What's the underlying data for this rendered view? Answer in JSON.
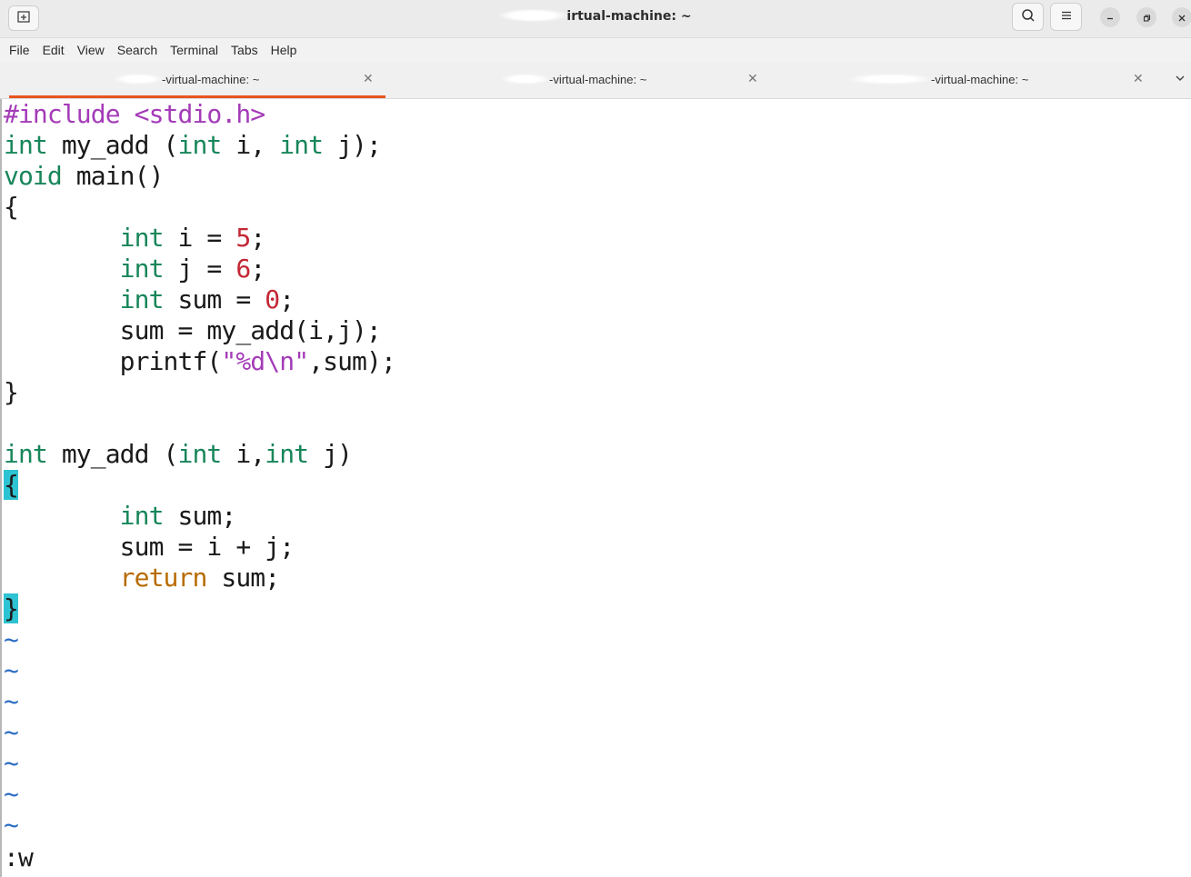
{
  "window": {
    "title": "irtual-machine: ~"
  },
  "menubar": [
    "File",
    "Edit",
    "View",
    "Search",
    "Terminal",
    "Tabs",
    "Help"
  ],
  "tabs": [
    {
      "label": "-virtual-machine: ~",
      "active": true
    },
    {
      "label": "-virtual-machine: ~",
      "active": false
    },
    {
      "label": "-virtual-machine: ~",
      "active": false
    }
  ],
  "colors": {
    "accent_tab": "#e95420",
    "keyword_type": "#18865a",
    "preprocessor": "#a43bb8",
    "number": "#c42734",
    "string": "#a43bb8",
    "return": "#b76b00",
    "tilde": "#2a6cc4",
    "brace_highlight": "#2ec3d2"
  },
  "icons": {
    "new_tab": "new-tab-icon",
    "search": "search-icon",
    "menu": "hamburger-menu-icon",
    "minimize": "minimize-icon",
    "maximize": "restore-icon",
    "close": "close-icon",
    "tab_close": "close-icon",
    "tabs_dropdown": "chevron-down-icon"
  },
  "editor": {
    "lines": [
      [
        {
          "t": "#include <stdio.h>",
          "c": "c-pre"
        }
      ],
      [
        {
          "t": "int",
          "c": "c-type"
        },
        {
          "t": " my_add ("
        },
        {
          "t": "int",
          "c": "c-type"
        },
        {
          "t": " i, "
        },
        {
          "t": "int",
          "c": "c-type"
        },
        {
          "t": " j);"
        }
      ],
      [
        {
          "t": "void",
          "c": "c-type"
        },
        {
          "t": " main()"
        }
      ],
      [
        {
          "t": "{"
        }
      ],
      [
        {
          "t": "        "
        },
        {
          "t": "int",
          "c": "c-type"
        },
        {
          "t": " i = "
        },
        {
          "t": "5",
          "c": "c-num"
        },
        {
          "t": ";"
        }
      ],
      [
        {
          "t": "        "
        },
        {
          "t": "int",
          "c": "c-type"
        },
        {
          "t": " j = "
        },
        {
          "t": "6",
          "c": "c-num"
        },
        {
          "t": ";"
        }
      ],
      [
        {
          "t": "        "
        },
        {
          "t": "int",
          "c": "c-type"
        },
        {
          "t": " sum = "
        },
        {
          "t": "0",
          "c": "c-num"
        },
        {
          "t": ";"
        }
      ],
      [
        {
          "t": "        sum = my_add(i,j);"
        }
      ],
      [
        {
          "t": "        printf("
        },
        {
          "t": "\"",
          "c": "c-str"
        },
        {
          "t": "%d\\n",
          "c": "c-str"
        },
        {
          "t": "\"",
          "c": "c-str"
        },
        {
          "t": ",sum);"
        }
      ],
      [
        {
          "t": "}"
        }
      ],
      [
        {
          "t": ""
        }
      ],
      [
        {
          "t": "int",
          "c": "c-type"
        },
        {
          "t": " my_add ("
        },
        {
          "t": "int",
          "c": "c-type"
        },
        {
          "t": " i,"
        },
        {
          "t": "int",
          "c": "c-type"
        },
        {
          "t": " j)"
        }
      ],
      [
        {
          "t": "{",
          "c": "c-brace-hl"
        }
      ],
      [
        {
          "t": "        "
        },
        {
          "t": "int",
          "c": "c-type"
        },
        {
          "t": " sum;"
        }
      ],
      [
        {
          "t": "        sum = i + j;"
        }
      ],
      [
        {
          "t": "        "
        },
        {
          "t": "return",
          "c": "c-ret"
        },
        {
          "t": " sum;"
        }
      ],
      [
        {
          "t": "}",
          "c": "c-brace-hl"
        }
      ],
      [
        {
          "t": "~",
          "c": "c-tilde"
        }
      ],
      [
        {
          "t": "~",
          "c": "c-tilde"
        }
      ],
      [
        {
          "t": "~",
          "c": "c-tilde"
        }
      ],
      [
        {
          "t": "~",
          "c": "c-tilde"
        }
      ],
      [
        {
          "t": "~",
          "c": "c-tilde"
        }
      ],
      [
        {
          "t": "~",
          "c": "c-tilde"
        }
      ],
      [
        {
          "t": "~",
          "c": "c-tilde"
        }
      ]
    ],
    "command_line": ":w"
  }
}
